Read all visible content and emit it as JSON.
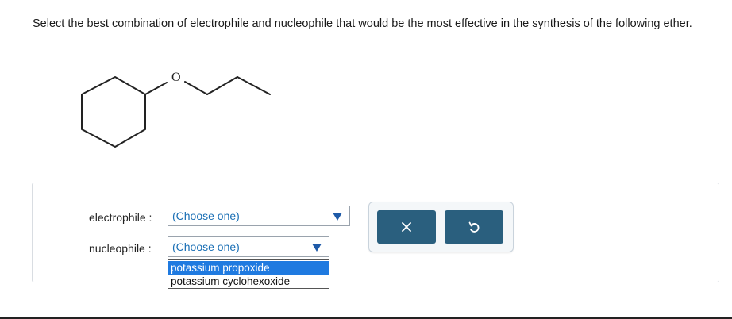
{
  "question": {
    "text": "Select the best combination of electrophile and nucleophile that would be the most effective in the synthesis of the following ether."
  },
  "molecule": {
    "atom_label": "O"
  },
  "form": {
    "electrophile_label": "electrophile :",
    "electrophile_value": "(Choose one)",
    "nucleophile_label": "nucleophile :",
    "nucleophile_value": "(Choose one)",
    "nucleophile_options": [
      "potassium propoxide",
      "potassium cyclohexoxide"
    ]
  },
  "buttons": {
    "clear_icon": "x-icon",
    "undo_icon": "undo-icon"
  },
  "colors": {
    "accent": "#2a5f7e",
    "link": "#1a6fb5",
    "highlight": "#1f7ae0"
  }
}
